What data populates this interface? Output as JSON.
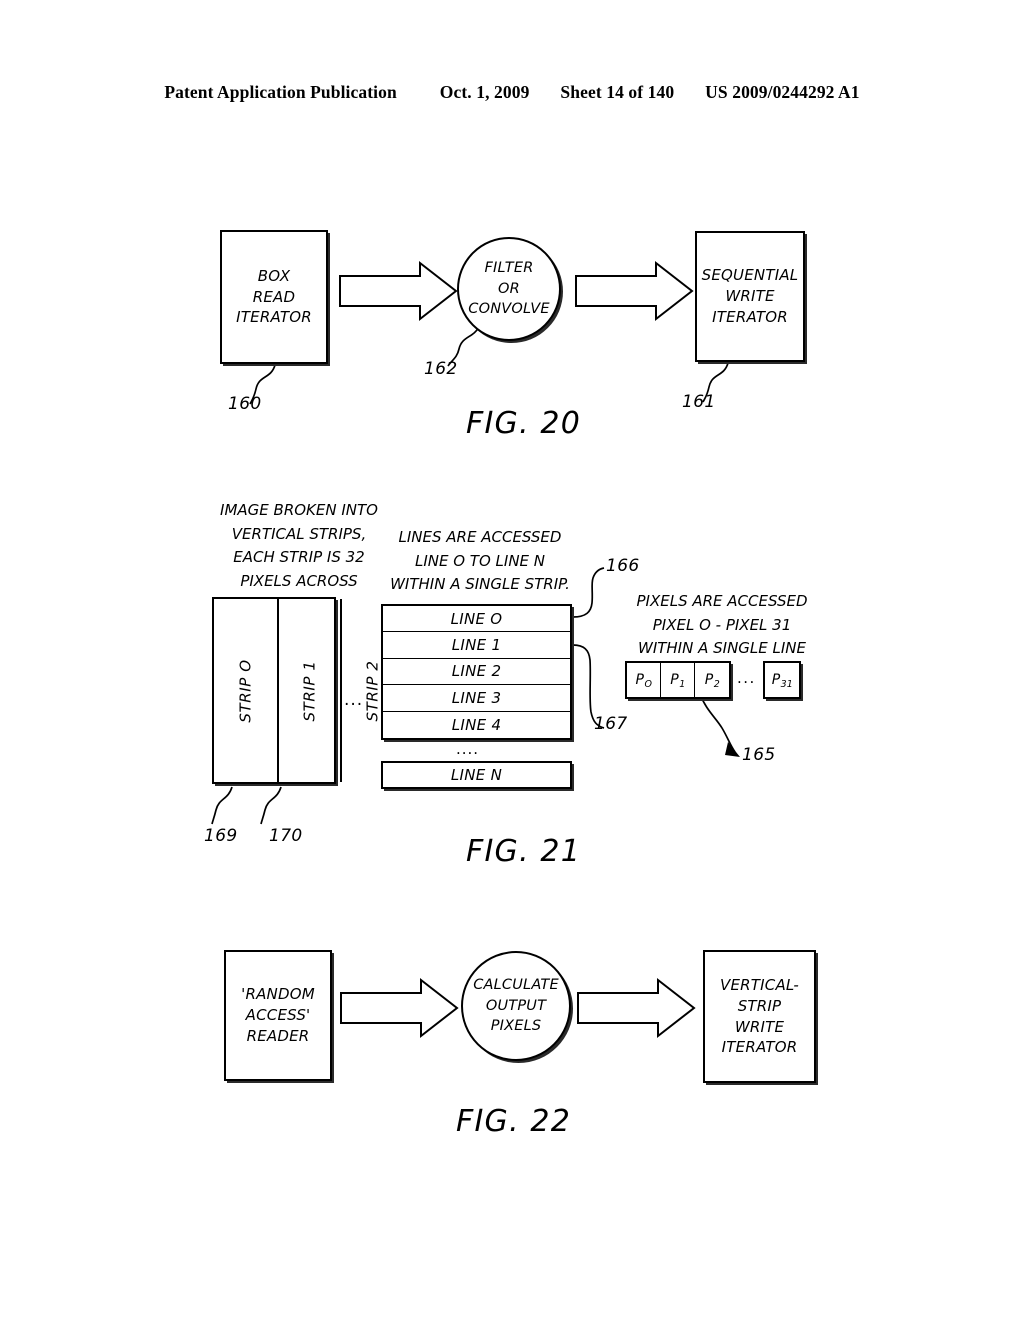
{
  "header": {
    "publication": "Patent Application Publication",
    "date": "Oct. 1, 2009",
    "sheet": "Sheet 14 of 140",
    "doc_number": "US 2009/0244292 A1"
  },
  "fig20": {
    "caption": "FIG. 20",
    "source_box": {
      "line1": "BOX",
      "line2": "READ",
      "line3": "ITERATOR",
      "ref": "160"
    },
    "process_ellipse": {
      "line1": "FILTER",
      "line2": "OR",
      "line3": "CONVOLVE",
      "ref": "162"
    },
    "target_box": {
      "line1": "SEQUENTIAL",
      "line2": "WRITE",
      "line3": "ITERATOR",
      "ref": "161"
    }
  },
  "fig21": {
    "caption": "FIG. 21",
    "strips_note": {
      "line1": "IMAGE BROKEN INTO",
      "line2": "VERTICAL STRIPS,",
      "line3": "EACH STRIP IS 32",
      "line4": "PIXELS ACROSS"
    },
    "lines_note": {
      "line1": "LINES ARE ACCESSED",
      "line2": "LINE O TO LINE N",
      "line3": "WITHIN A SINGLE STRIP."
    },
    "pixels_note": {
      "line1": "PIXELS ARE ACCESSED",
      "line2": "PIXEL O - PIXEL 31",
      "line3": "WITHIN A SINGLE LINE"
    },
    "strips": [
      "STRIP O",
      "STRIP 1",
      "STRIP 2"
    ],
    "strips_ellipsis": "...",
    "strip_refs": {
      "strip": "169",
      "boundary": "170"
    },
    "lines": [
      "LINE O",
      "LINE 1",
      "LINE 2",
      "LINE 3",
      "LINE 4"
    ],
    "lines_ellipsis": "....",
    "line_last": "LINE N",
    "line_refs": {
      "single_line": "166",
      "line_group": "167"
    },
    "pixels": [
      {
        "base": "P",
        "sub": "O"
      },
      {
        "base": "P",
        "sub": "1"
      },
      {
        "base": "P",
        "sub": "2"
      }
    ],
    "pixels_ellipsis": "...",
    "pixel_last": {
      "base": "P",
      "sub": "31"
    },
    "pixel_ref": "165"
  },
  "fig22": {
    "caption": "FIG. 22",
    "source_box": {
      "line1": "'RANDOM",
      "line2": "ACCESS'",
      "line3": "READER"
    },
    "process_ellipse": {
      "line1": "CALCULATE",
      "line2": "OUTPUT",
      "line3": "PIXELS"
    },
    "target_box": {
      "line1": "VERTICAL-",
      "line2": "STRIP",
      "line3": "WRITE",
      "line4": "ITERATOR"
    }
  },
  "colors": {
    "ink": "#000000",
    "paper": "#ffffff"
  }
}
